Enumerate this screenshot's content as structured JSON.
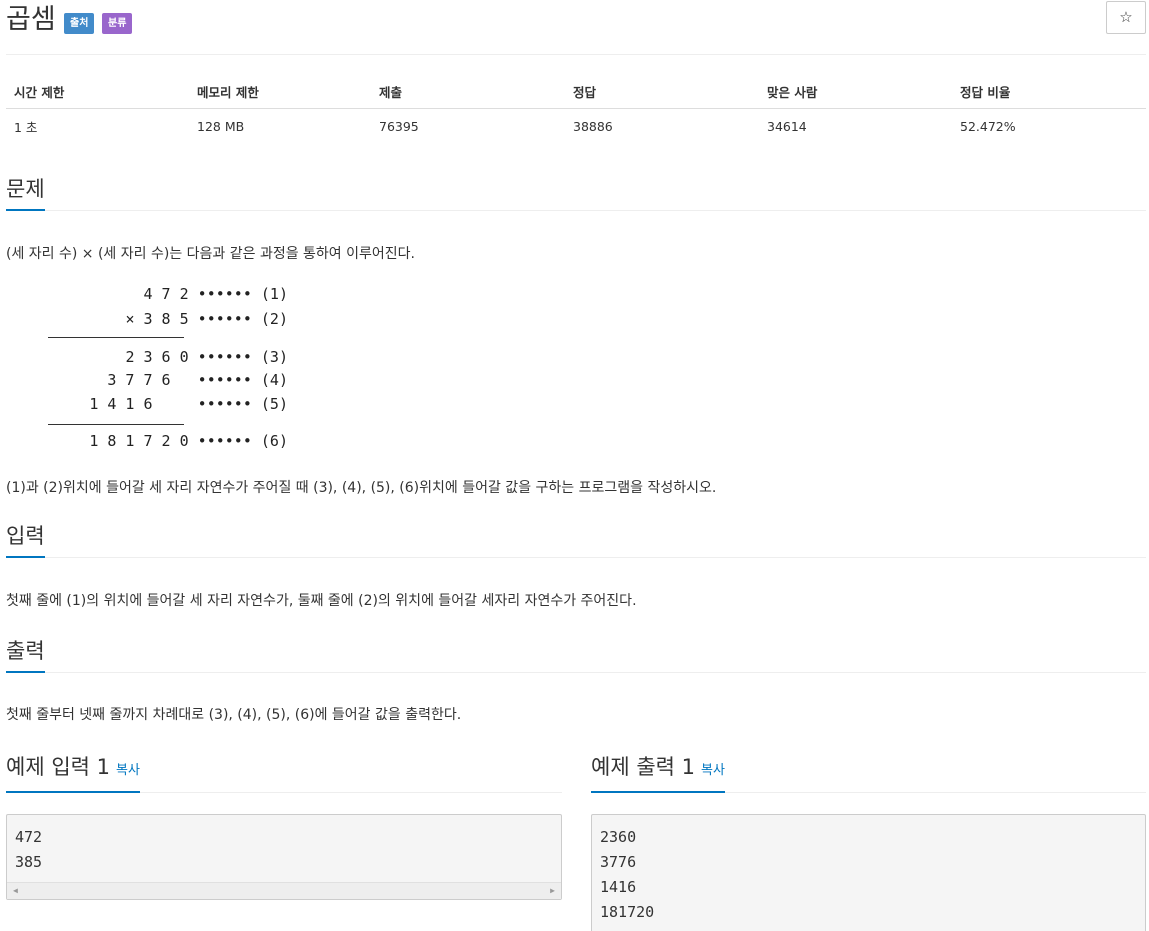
{
  "problem": {
    "title": "곱셈",
    "tags": [
      {
        "label": "출처",
        "color": "#428bca"
      },
      {
        "label": "분류",
        "color": "#9966cc"
      }
    ],
    "star": "☆"
  },
  "info_table": {
    "headers": [
      "시간 제한",
      "메모리 제한",
      "제출",
      "정답",
      "맞은 사람",
      "정답 비율"
    ],
    "values": [
      "1 초",
      "128 MB",
      "76395",
      "38886",
      "34614",
      "52.472%"
    ]
  },
  "sections": {
    "problem": {
      "heading": "문제",
      "intro": "(세 자리 수) × (세 자리 수)는 다음과 같은 과정을 통하여 이루어진다.",
      "diagram": [
        "4 7 2 •••••• (1)",
        "× 3 8 5 •••••• (2)",
        "2 3 6 0 •••••• (3)",
        "3 7 7 6   •••••• (4)",
        "1 4 1 6     •••••• (5)",
        "1 8 1 7 2 0 •••••• (6)"
      ],
      "outro": "(1)과 (2)위치에 들어갈 세 자리 자연수가 주어질 때 (3), (4), (5), (6)위치에 들어갈 값을 구하는 프로그램을 작성하시오."
    },
    "input": {
      "heading": "입력",
      "text": "첫째 줄에 (1)의 위치에 들어갈 세 자리 자연수가, 둘째 줄에 (2)의 위치에 들어갈 세자리 자연수가 주어진다."
    },
    "output": {
      "heading": "출력",
      "text": "첫째 줄부터 넷째 줄까지 차례대로 (3), (4), (5), (6)에 들어갈 값을 출력한다."
    }
  },
  "samples": {
    "input": {
      "heading": "예제 입력 1",
      "copy": "복사",
      "lines": [
        "472",
        "385"
      ]
    },
    "output": {
      "heading": "예제 출력 1",
      "copy": "복사",
      "lines": [
        "2360",
        "3776",
        "1416",
        "181720"
      ]
    }
  },
  "colors": {
    "accent": "#0076c0",
    "tag_source": "#428bca",
    "tag_category": "#9966cc"
  },
  "icons": {
    "star": "star-outline-icon",
    "scroll_left": "triangle-left-icon",
    "scroll_right": "triangle-right-icon"
  }
}
